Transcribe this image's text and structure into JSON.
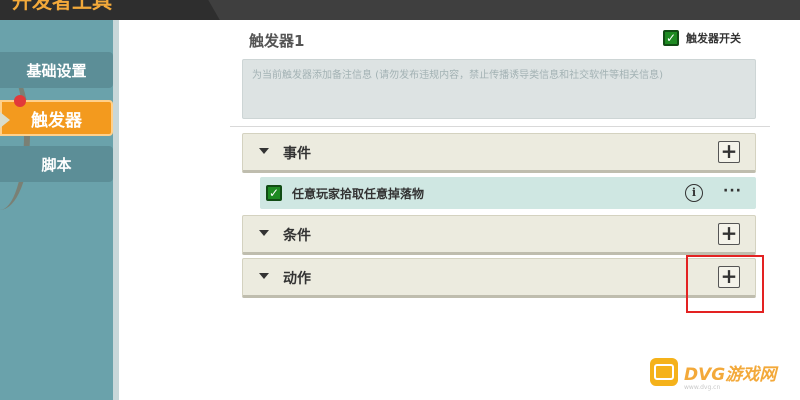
{
  "window": {
    "title": "开发者工具"
  },
  "sidebar": {
    "items": [
      {
        "label": "基础设置"
      },
      {
        "label": "触发器"
      },
      {
        "label": "脚本"
      }
    ]
  },
  "trigger": {
    "name": "触发器1",
    "enabled_label": "触发器开关",
    "enabled": true,
    "note_placeholder": "为当前触发器添加备注信息 (请勿发布违规内容，禁止传播诱导类信息和社交软件等相关信息)"
  },
  "sections": {
    "event": {
      "label": "事件",
      "add": "+"
    },
    "condition": {
      "label": "条件",
      "add": "+"
    },
    "action": {
      "label": "动作",
      "add": "+"
    }
  },
  "events": [
    {
      "label": "任意玩家拾取任意掉落物",
      "checked": true,
      "info": "i",
      "more": "···"
    }
  ],
  "watermark": {
    "text": "DVG游戏网",
    "sub": "www.dvg.cn"
  },
  "colors": {
    "accent": "#f39a1e",
    "sidebar": "#6aa2ab",
    "highlight": "#e32222",
    "check": "#1e8a22"
  }
}
